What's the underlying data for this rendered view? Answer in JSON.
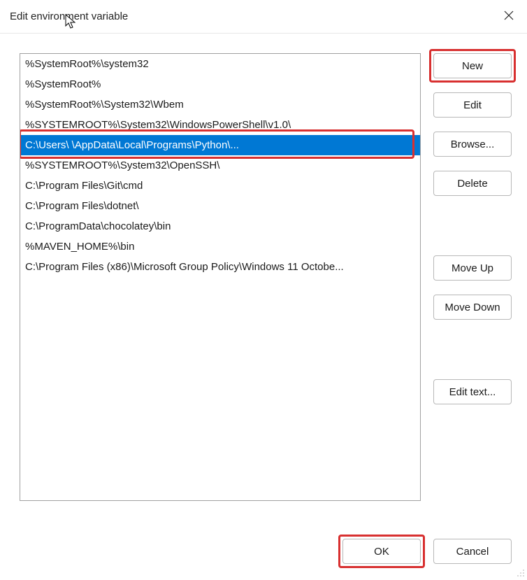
{
  "title": "Edit environment variable",
  "selected_index": 4,
  "list_items": [
    "%SystemRoot%\\system32",
    "%SystemRoot%",
    "%SystemRoot%\\System32\\Wbem",
    "%SYSTEMROOT%\\System32\\WindowsPowerShell\\v1.0\\",
    "C:\\Users\\                                      \\AppData\\Local\\Programs\\Python\\...",
    "%SYSTEMROOT%\\System32\\OpenSSH\\",
    "C:\\Program Files\\Git\\cmd",
    "C:\\Program Files\\dotnet\\",
    "C:\\ProgramData\\chocolatey\\bin",
    "%MAVEN_HOME%\\bin",
    "C:\\Program Files (x86)\\Microsoft Group Policy\\Windows 11 Octobe..."
  ],
  "buttons": {
    "new": "New",
    "edit": "Edit",
    "browse": "Browse...",
    "delete": "Delete",
    "move_up": "Move Up",
    "move_down": "Move Down",
    "edit_text": "Edit text...",
    "ok": "OK",
    "cancel": "Cancel"
  }
}
